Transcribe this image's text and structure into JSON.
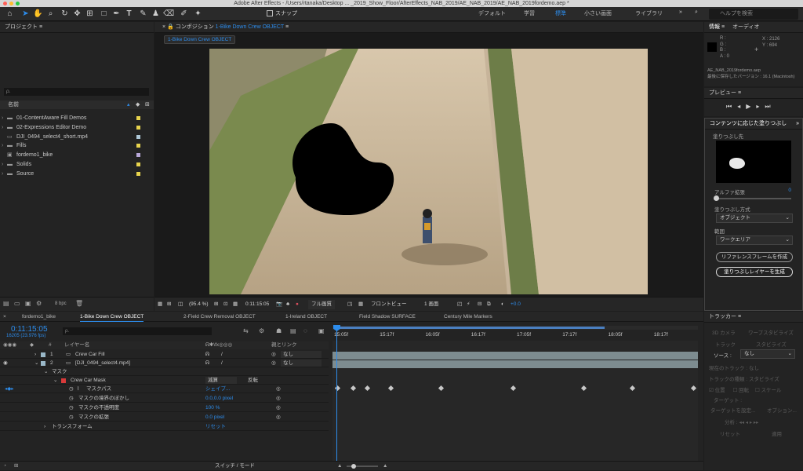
{
  "window": {
    "title": "Adobe After Effects - /Users/rtanaka/Desktop ... _2019_Show_Floor/AfterEffects_NAB_2019/AE_NAB_2019/AE_NAB_2019fordemo.aep *"
  },
  "toolbar": {
    "snap_label": "スナップ"
  },
  "workspaces": [
    "デフォルト",
    "学習",
    "標準",
    "小さい画面",
    "ライブラリ"
  ],
  "workspace_active_index": 2,
  "help_search": {
    "placeholder": "ヘルプを検索"
  },
  "project": {
    "title": "プロジェクト",
    "name_column": "名前",
    "search_placeholder": "ρ.",
    "items": [
      {
        "name": "01-ContentAware Fill Demos",
        "type": "folder",
        "color": "#e8d44d"
      },
      {
        "name": "02-Expressions Editor Demo",
        "type": "folder",
        "color": "#e8d44d"
      },
      {
        "name": "DJI_0494_select4_short.mp4",
        "type": "footage",
        "color": "#aec8d8"
      },
      {
        "name": "Fills",
        "type": "folder",
        "color": "#e8d44d"
      },
      {
        "name": "fordemo1_bike",
        "type": "comp",
        "color": "#b8a8d8"
      },
      {
        "name": "Solids",
        "type": "folder",
        "color": "#e8d44d"
      },
      {
        "name": "Source",
        "type": "folder",
        "color": "#e8d44d"
      }
    ],
    "bpc": "8 bpc"
  },
  "composition": {
    "panel_prefix": "コンポジション",
    "name": "1-Bike Down Crew OBJECT",
    "zoom": "(95.4 %)",
    "timecode": "0:11:15:05",
    "resolution": "フル画質",
    "view": "フロントビュー",
    "views_count": "1 画面",
    "exposure": "+0.0"
  },
  "info": {
    "title": "情報",
    "audio_tab": "オーディオ",
    "r": "R :",
    "g": "G :",
    "b": "B :",
    "a": "A :  0",
    "x": "X : 2126",
    "y": "Y :  694",
    "file": "AE_NAB_2019fordemo.aep",
    "saved": "最後に保存したバージョン : 16.1 (Macintosh)"
  },
  "preview": {
    "title": "プレビュー"
  },
  "caf": {
    "title": "コンテンツに応じた塗りつぶし",
    "target_label": "塗りつぶし先",
    "alpha_label": "アルファ拡張",
    "alpha_value": "0",
    "alpha_level": 0,
    "method_label": "塗りつぶし方式",
    "method_value": "オブジェクト",
    "range_label": "範囲",
    "range_value": "ワークエリア",
    "ref_button": "リファレンスフレームを作成",
    "gen_button": "塗りつぶしレイヤーを生成"
  },
  "timeline": {
    "tabs": [
      "fordemo1_bike",
      "1-Bike Down Crew OBJECT",
      "2-Field Crew Removal OBJECT",
      "1-Ireland OBJECT",
      "Field Shadow SURFACE",
      "Century Mile Markers"
    ],
    "active_tab": 1,
    "timecode": "0:11:15:05",
    "frame_info": "16205 (23.976 fps)",
    "col_layer": "レイヤー名",
    "col_parent": "親とリンク",
    "ruler": [
      "15:05f",
      "15:17f",
      "16:05f",
      "16:17f",
      "17:05f",
      "17:17f",
      "18:05f",
      "18:17f"
    ],
    "layers": [
      {
        "num": "1",
        "name": "Crew Car Fill",
        "color": "#9ab8c8",
        "parent": "なし"
      },
      {
        "num": "2",
        "name": "[DJI_0494_select4.mp4]",
        "color": "#9ab8c8",
        "parent": "なし"
      }
    ],
    "mask_group": "マスク",
    "mask_name": "Crew Car Mask",
    "mask_mode": "減算",
    "mask_invert": "反転",
    "props": [
      {
        "name": "マスクパス",
        "value": "シェイプ..."
      },
      {
        "name": "マスクの境界のぼかし",
        "value": "0.0,0.0 pixel"
      },
      {
        "name": "マスクの不透明度",
        "value": "100 %"
      },
      {
        "name": "マスクの拡張",
        "value": "0.0 pixel"
      }
    ],
    "transform": "トランスフォーム",
    "transform_value": "リセット",
    "switch_mode": "スイッチ / モード"
  },
  "tracker": {
    "title": "トラッカー",
    "camera": "3D カメラ",
    "warp": "ワープスタビライズ",
    "track": "トラック",
    "stabilize": "スタビライズ",
    "source_label": "ソース :",
    "source_value": "なし",
    "current_track": "現在のトラック :",
    "current_track_value": "なし",
    "track_type": "トラックの種類 :",
    "track_type_value": "スタビライズ",
    "position": "位置",
    "rotation": "回転",
    "scale": "スケール",
    "target": "ターゲット :",
    "set_target": "ターゲットを設定...",
    "options": "オプション...",
    "analyze": "分析 :",
    "reset": "リセット",
    "apply": "適用"
  }
}
